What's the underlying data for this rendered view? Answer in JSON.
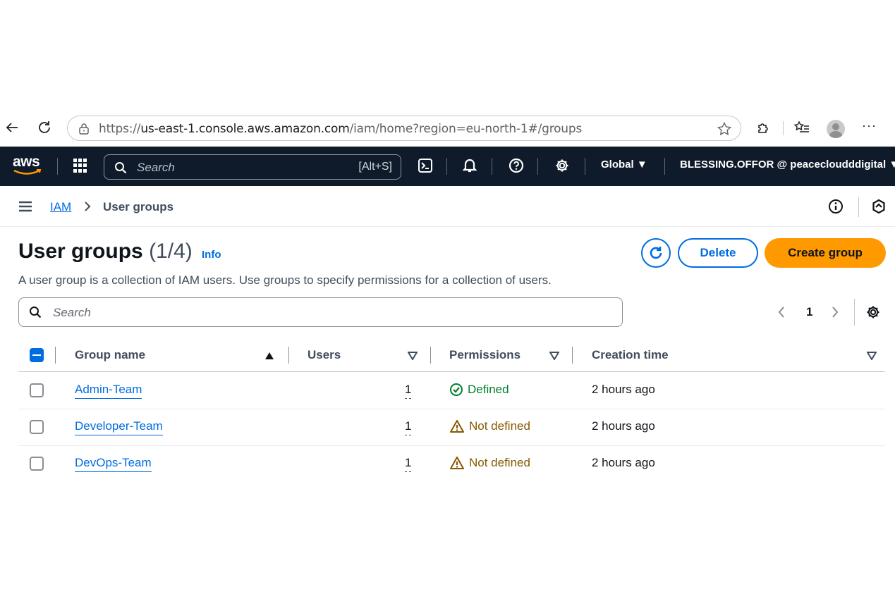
{
  "browser": {
    "url_prefix": "https://",
    "url_host": "us-east-1.console.aws.amazon.com",
    "url_path": "/iam/home?region=eu-north-1#/groups",
    "more_label": "···"
  },
  "awsnav": {
    "logo_text": "aws",
    "search_placeholder": "Search",
    "search_shortcut": "[Alt+S]",
    "region_label": "Global ▼",
    "account_label": "BLESSING.OFFOR @ peacecloudddigital ▼"
  },
  "breadcrumb": {
    "root": "IAM",
    "current": "User groups"
  },
  "header": {
    "title": "User groups",
    "count": "(1/4)",
    "info_label": "Info",
    "description": "A user group is a collection of IAM users. Use groups to specify permissions for a collection of users."
  },
  "actions": {
    "delete_label": "Delete",
    "create_label": "Create group"
  },
  "filter": {
    "placeholder": "Search"
  },
  "pagination": {
    "current_page": "1"
  },
  "table": {
    "columns": [
      "Group name",
      "Users",
      "Permissions",
      "Creation time"
    ],
    "rows": [
      {
        "name": "Admin-Team",
        "users": "1",
        "permissions": "Defined",
        "permissions_status": "ok",
        "created": "2 hours ago"
      },
      {
        "name": "Developer-Team",
        "users": "1",
        "permissions": "Not defined",
        "permissions_status": "warn",
        "created": "2 hours ago"
      },
      {
        "name": "DevOps-Team",
        "users": "1",
        "permissions": "Not defined",
        "permissions_status": "warn",
        "created": "2 hours ago"
      }
    ]
  },
  "colors": {
    "nav_bg": "#0f1b2a",
    "link_blue": "#006ce0",
    "primary_orange": "#ff9900",
    "success_green": "#00802f",
    "warning_brown": "#855900"
  }
}
